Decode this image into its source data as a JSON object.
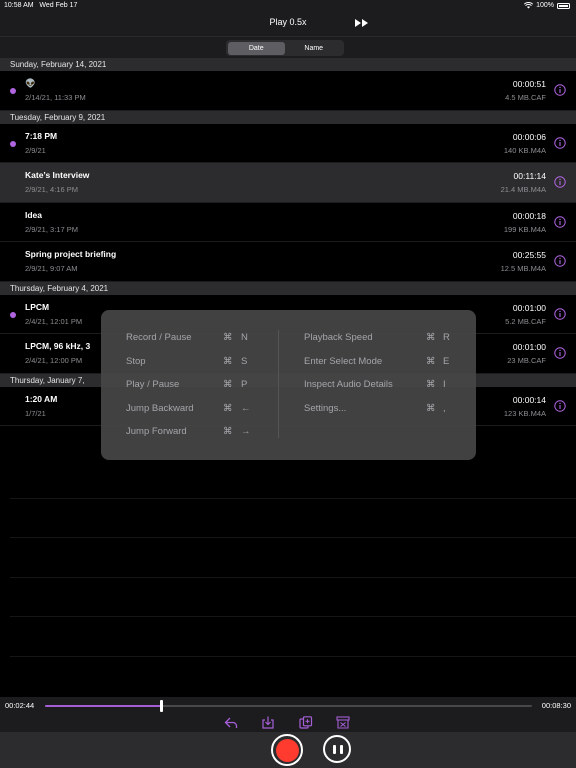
{
  "status_bar": {
    "time": "10:58 AM",
    "date": "Wed Feb 17",
    "battery": "100%"
  },
  "nav": {
    "title": "Play 0.5x",
    "fast_forward_icon": "fast-forward-icon"
  },
  "segmented": {
    "date_label": "Date",
    "name_label": "Name",
    "selected": "Date"
  },
  "accent_color": "#b065e0",
  "sections": [
    {
      "header": "Sunday, February 14, 2021",
      "rows": [
        {
          "name": "👽",
          "date": "2/14/21, 11:33 PM",
          "duration": "00:00:51",
          "size": "4.5 MB.CAF",
          "unplayed": true,
          "selected": false
        }
      ]
    },
    {
      "header": "Tuesday, February 9, 2021",
      "rows": [
        {
          "name": "7:18 PM",
          "date": "2/9/21",
          "duration": "00:00:06",
          "size": "140 KB.M4A",
          "unplayed": true,
          "selected": false
        },
        {
          "name": "Kate’s Interview",
          "date": "2/9/21, 4:16 PM",
          "duration": "00:11:14",
          "size": "21.4 MB.M4A",
          "unplayed": false,
          "selected": true
        },
        {
          "name": "Idea",
          "date": "2/9/21, 3:17 PM",
          "duration": "00:00:18",
          "size": "199 KB.M4A",
          "unplayed": false,
          "selected": false
        },
        {
          "name": "Spring project briefing",
          "date": "2/9/21, 9:07 AM",
          "duration": "00:25:55",
          "size": "12.5 MB.M4A",
          "unplayed": false,
          "selected": false
        }
      ]
    },
    {
      "header": "Thursday, February 4, 2021",
      "rows": [
        {
          "name": "LPCM",
          "date": "2/4/21, 12:01 PM",
          "duration": "00:01:00",
          "size": "5.2 MB.CAF",
          "unplayed": true,
          "selected": false
        },
        {
          "name": "LPCM, 96 kHz, 3",
          "date": "2/4/21, 12:00 PM",
          "duration": "00:01:00",
          "size": "23 MB.CAF",
          "unplayed": false,
          "selected": false
        }
      ]
    },
    {
      "header": "Thursday, January 7,",
      "rows": [
        {
          "name": "1:20 AM",
          "date": "1/7/21",
          "duration": "00:00:14",
          "size": "123 KB.M4A",
          "unplayed": false,
          "selected": false
        }
      ]
    }
  ],
  "shortcuts": {
    "left": [
      {
        "label": "Record / Pause",
        "cmd": "⌘",
        "key": "N"
      },
      {
        "label": "Stop",
        "cmd": "⌘",
        "key": "S"
      },
      {
        "label": "Play / Pause",
        "cmd": "⌘",
        "key": "P"
      },
      {
        "label": "Jump Backward",
        "cmd": "⌘",
        "key": "←"
      },
      {
        "label": "Jump Forward",
        "cmd": "⌘",
        "key": "→"
      }
    ],
    "right": [
      {
        "label": "Playback Speed",
        "cmd": "⌘",
        "key": "R"
      },
      {
        "label": "Enter Select Mode",
        "cmd": "⌘",
        "key": "E"
      },
      {
        "label": "Inspect Audio Details",
        "cmd": "⌘",
        "key": "I"
      },
      {
        "label": "Settings...",
        "cmd": "⌘",
        "key": ","
      }
    ]
  },
  "playback": {
    "elapsed": "00:02:44",
    "total": "00:08:30",
    "progress_fraction": 0.24,
    "tools": [
      "share-icon",
      "download-icon",
      "duplicate-icon",
      "trim-icon"
    ]
  }
}
